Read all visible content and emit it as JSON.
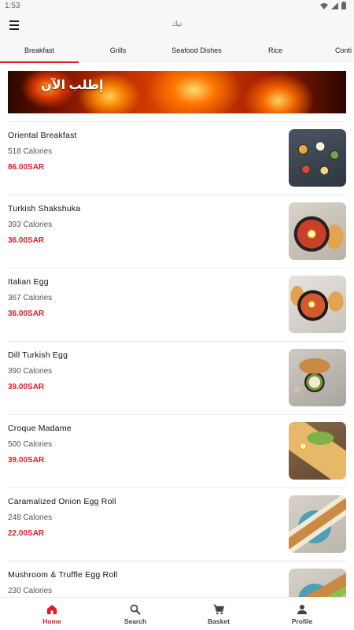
{
  "status_bar": {
    "time": "1:53"
  },
  "app_bar": {
    "logo_text": "تيك"
  },
  "tabs": [
    {
      "label": "Breakfast",
      "active": true
    },
    {
      "label": "Grills",
      "active": false
    },
    {
      "label": "Seafood Dishes",
      "active": false
    },
    {
      "label": "Rice",
      "active": false
    },
    {
      "label": "Conti",
      "active": false
    }
  ],
  "banner": {
    "text": "إطلب الآن"
  },
  "menu_items": [
    {
      "name": "Oriental Breakfast",
      "calories": "518 Calories",
      "price": "86.00SAR"
    },
    {
      "name": "Turkish Shakshuka",
      "calories": "393 Calories",
      "price": "36.00SAR"
    },
    {
      "name": "Italian Egg",
      "calories": "367 Calories",
      "price": "36.00SAR"
    },
    {
      "name": "Dill Turkish Egg",
      "calories": "390 Calories",
      "price": "39.00SAR"
    },
    {
      "name": "Croque Madame",
      "calories": "500 Calories",
      "price": "39.00SAR"
    },
    {
      "name": "Caramalized Onion Egg Roll",
      "calories": "248 Calories",
      "price": "22.00SAR"
    },
    {
      "name": "Mushroom & Truffle Egg Roll",
      "calories": "230 Calories",
      "price": ""
    }
  ],
  "bottom_nav": [
    {
      "label": "Home",
      "icon": "home-icon",
      "active": true
    },
    {
      "label": "Search",
      "icon": "search-icon",
      "active": false
    },
    {
      "label": "Basket",
      "icon": "cart-icon",
      "active": false
    },
    {
      "label": "Profile",
      "icon": "person-icon",
      "active": false
    }
  ],
  "colors": {
    "accent": "#e11d2a",
    "background": "#f7f7f7",
    "card": "#ffffff"
  }
}
